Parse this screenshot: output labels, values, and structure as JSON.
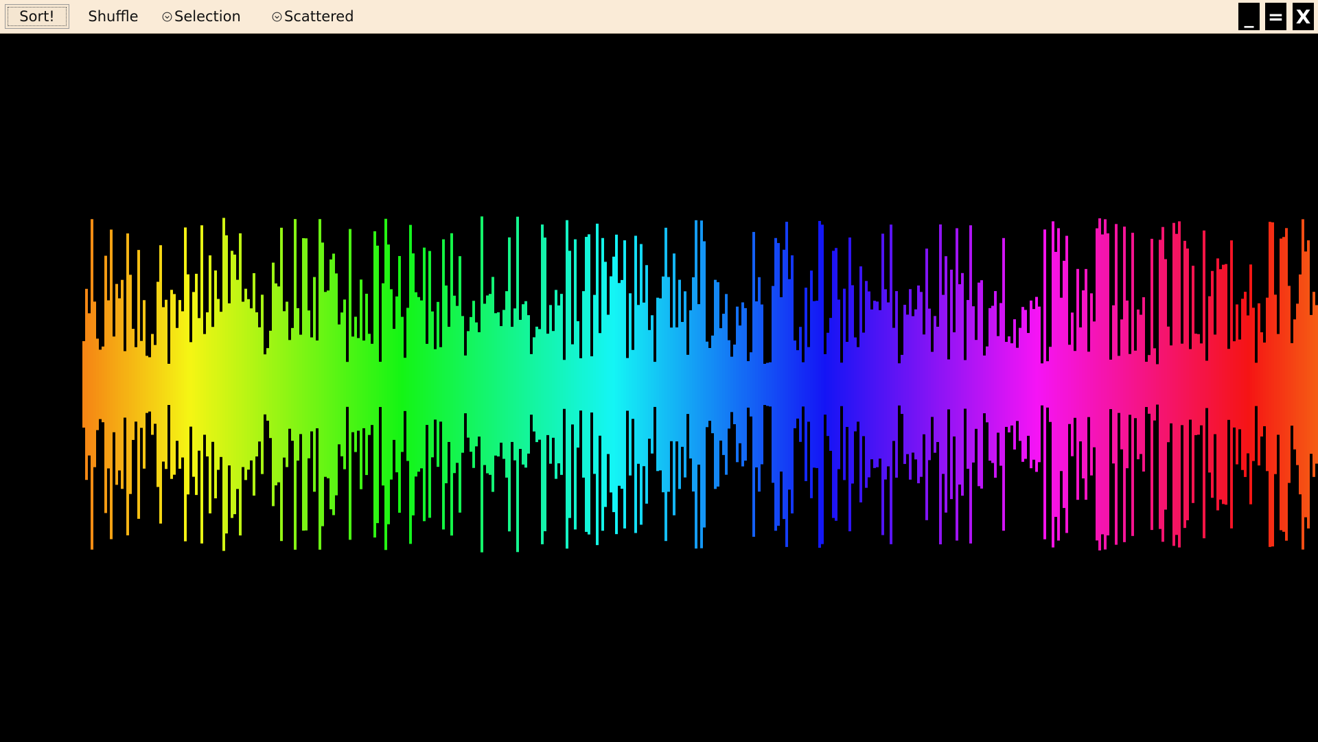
{
  "toolbar": {
    "sort_label": "Sort!",
    "shuffle_label": "Shuffle",
    "algorithm_label": "Selection",
    "pattern_label": "Scattered",
    "minimize_label": "_",
    "maximize_label": "=",
    "close_label": "X"
  },
  "icons": {
    "dropdown": "chevron-down-icon"
  },
  "colors": {
    "toolbar_bg": "#faebd7",
    "canvas_bg": "#000000",
    "window_buttons_bg": "#000000",
    "window_buttons_fg": "#ffffff"
  }
}
